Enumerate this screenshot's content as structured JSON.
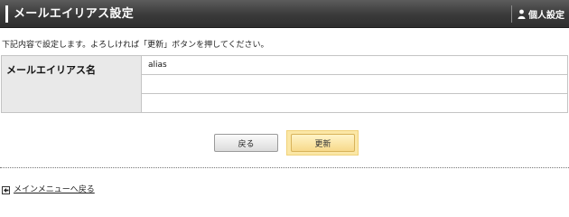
{
  "header": {
    "title": "メールエイリアス設定",
    "user_label": "個人設定",
    "user_icon": "person-icon"
  },
  "instruction": "下記内容で設定します。よろしければ「更新」ボタンを押してください。",
  "form": {
    "label": "メールエイリアス名",
    "values": [
      "alias",
      "",
      ""
    ]
  },
  "buttons": {
    "back": "戻る",
    "update": "更新"
  },
  "footer": {
    "link_label": "メインメニューへ戻る",
    "link_icon": "arrow-left-icon"
  }
}
